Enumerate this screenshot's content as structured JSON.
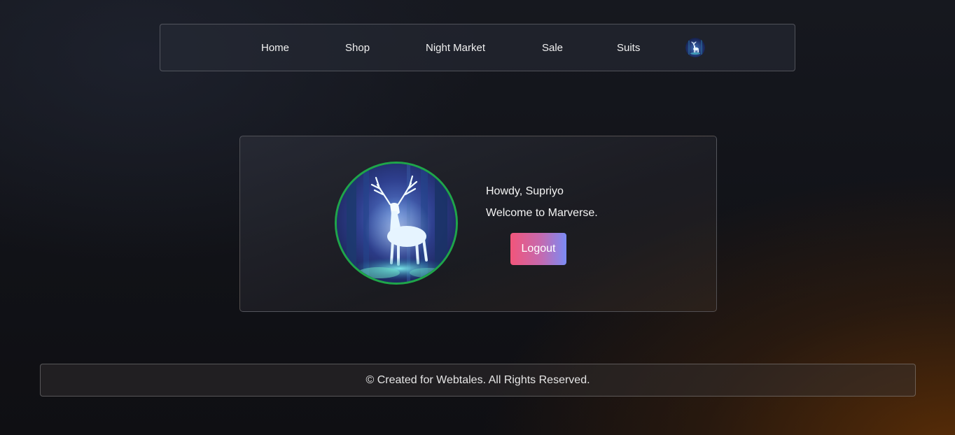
{
  "nav": {
    "items": [
      {
        "label": "Home"
      },
      {
        "label": "Shop"
      },
      {
        "label": "Night Market"
      },
      {
        "label": "Sale"
      },
      {
        "label": "Suits"
      }
    ],
    "avatar_icon": "stag-avatar-icon"
  },
  "profile": {
    "image_icon": "glowing-stag-image",
    "ring_color": "#1fa54a",
    "greeting": "Howdy, Supriyo",
    "welcome": "Welcome to Marverse.",
    "logout_label": "Logout"
  },
  "footer": {
    "text": "© Created for Webtales. All Rights Reserved."
  },
  "colors": {
    "accent_gradient_start": "#f2557a",
    "accent_gradient_end": "#7b8bf5",
    "background": "#111217",
    "glow": "#5c2e06"
  }
}
